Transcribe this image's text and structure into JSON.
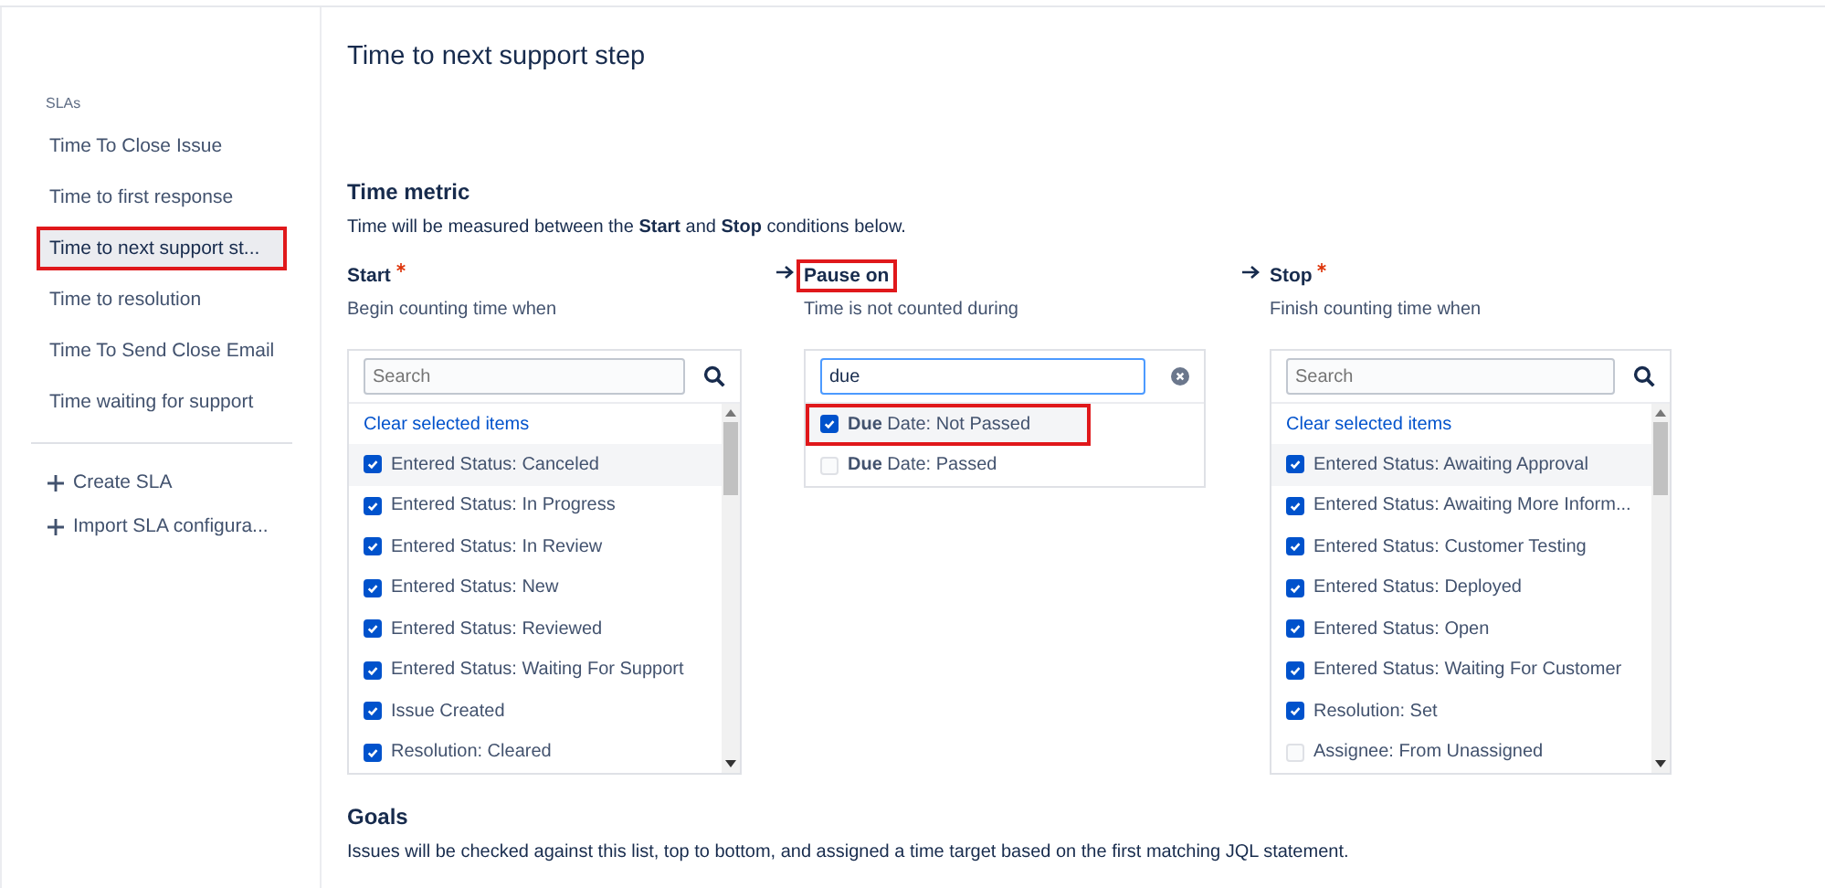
{
  "sidebar": {
    "heading": "SLAs",
    "items": [
      {
        "label": "Time To Close Issue",
        "selected": false,
        "highlighted": false
      },
      {
        "label": "Time to first response",
        "selected": false,
        "highlighted": false
      },
      {
        "label": "Time to next support st...",
        "selected": true,
        "highlighted": true
      },
      {
        "label": "Time to resolution",
        "selected": false,
        "highlighted": false
      },
      {
        "label": "Time To Send Close Email",
        "selected": false,
        "highlighted": false
      },
      {
        "label": "Time waiting for support",
        "selected": false,
        "highlighted": false
      }
    ],
    "actions": [
      {
        "label": "Create SLA"
      },
      {
        "label": "Import SLA configura..."
      }
    ]
  },
  "page_title": "Time to next support step",
  "time_metric": {
    "heading": "Time metric",
    "description": "Time will be measured between the **Start** and **Stop** conditions below.",
    "columns": [
      {
        "label": "Start",
        "required": true,
        "highlighted": false,
        "hint": "Begin counting time when",
        "search": {
          "placeholder": "Search"
        },
        "clear_link": "Clear selected items",
        "items": [
          {
            "label": "Entered Status: Canceled",
            "checked": true
          },
          {
            "label": "Entered Status: In Progress",
            "checked": true
          },
          {
            "label": "Entered Status: In Review",
            "checked": true
          },
          {
            "label": "Entered Status: New",
            "checked": true
          },
          {
            "label": "Entered Status: Reviewed",
            "checked": true
          },
          {
            "label": "Entered Status: Waiting For Support",
            "checked": true
          },
          {
            "label": "Issue Created",
            "checked": true
          },
          {
            "label": "Resolution: Cleared",
            "checked": true
          }
        ]
      },
      {
        "label": "Pause on",
        "required": false,
        "highlighted": true,
        "hint": "Time is not counted during",
        "search": {
          "value": "due"
        },
        "items": [
          {
            "label": "**Due** Date: Not Passed",
            "checked": true,
            "highlighted": true
          },
          {
            "label": "**Due** Date: Passed",
            "checked": false,
            "highlighted": false
          }
        ]
      },
      {
        "label": "Stop",
        "required": true,
        "highlighted": false,
        "hint": "Finish counting time when",
        "search": {
          "placeholder": "Search"
        },
        "clear_link": "Clear selected items",
        "items": [
          {
            "label": "Entered Status: Awaiting Approval",
            "checked": true
          },
          {
            "label": "Entered Status: Awaiting More Inform...",
            "checked": true
          },
          {
            "label": "Entered Status: Customer Testing",
            "checked": true
          },
          {
            "label": "Entered Status: Deployed",
            "checked": true
          },
          {
            "label": "Entered Status: Open",
            "checked": true
          },
          {
            "label": "Entered Status: Waiting For Customer",
            "checked": true
          },
          {
            "label": "Resolution: Set",
            "checked": true
          },
          {
            "label": "Assignee: From Unassigned",
            "checked": false
          }
        ]
      }
    ]
  },
  "goals": {
    "heading": "Goals",
    "description": "Issues will be checked against this list, top to bottom, and assigned a time target based on the first matching JQL statement."
  }
}
